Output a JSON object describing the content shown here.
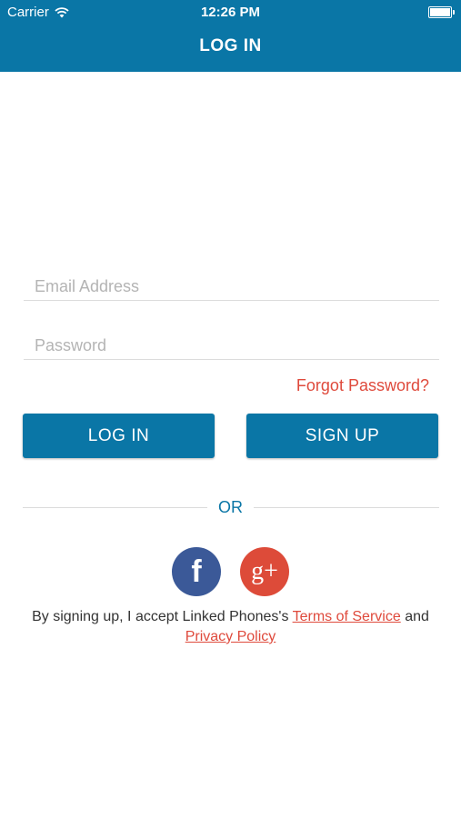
{
  "status_bar": {
    "carrier": "Carrier",
    "time": "12:26 PM"
  },
  "nav": {
    "title": "LOG IN"
  },
  "form": {
    "email_placeholder": "Email Address",
    "password_placeholder": "Password",
    "forgot_password": "Forgot Password?",
    "login_label": "LOG IN",
    "signup_label": "SIGN UP"
  },
  "divider": {
    "label": "OR"
  },
  "social": {
    "facebook_glyph": "f",
    "google_glyph": "g+"
  },
  "terms": {
    "prefix": "By signing up, I accept Linked Phones's",
    "terms_link": "Terms of Service",
    "and": "and",
    "privacy_link": "Privacy Policy"
  },
  "colors": {
    "primary": "#0a76a6",
    "accent": "#df4a3c",
    "facebook": "#3b5998",
    "google": "#dd4b39"
  }
}
